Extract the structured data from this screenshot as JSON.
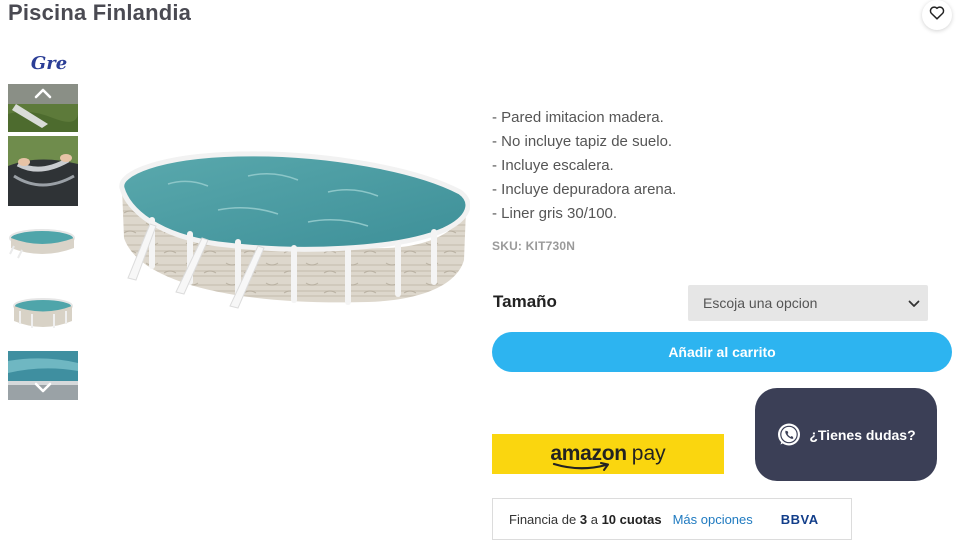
{
  "product": {
    "title": "Piscina Finlandia",
    "brand": "Gre",
    "description": [
      "- Pared imitacion madera.",
      "- No incluye tapiz de suelo.",
      "- Incluye escalera.",
      "- Incluye depuradora arena.",
      "- Liner gris 30/100."
    ],
    "sku": "SKU: KIT730N"
  },
  "options": {
    "size_label": "Tamaño",
    "size_placeholder": "Escoja una opcion"
  },
  "actions": {
    "add_to_cart": "Añadir al carrito",
    "amazon_word": "amazon",
    "pay_word": "pay"
  },
  "chat": {
    "label": "¿Tienes dudas?"
  },
  "financing": {
    "prefix": "Financia de",
    "min": "3",
    "connector": "a",
    "max": "10",
    "unit": "cuotas",
    "more_link": "Más opciones",
    "bank": "BBVA"
  },
  "icons": {
    "wishlist": "heart-icon",
    "thumb_up": "chevron-up-icon",
    "thumb_down": "chevron-down-icon",
    "select": "chevron-down-icon",
    "chat": "whatsapp-icon"
  },
  "colors": {
    "primary": "#2db4f0",
    "chat_bg": "#3b3f56",
    "amazon": "#fad60f",
    "bbva": "#123e8a"
  }
}
